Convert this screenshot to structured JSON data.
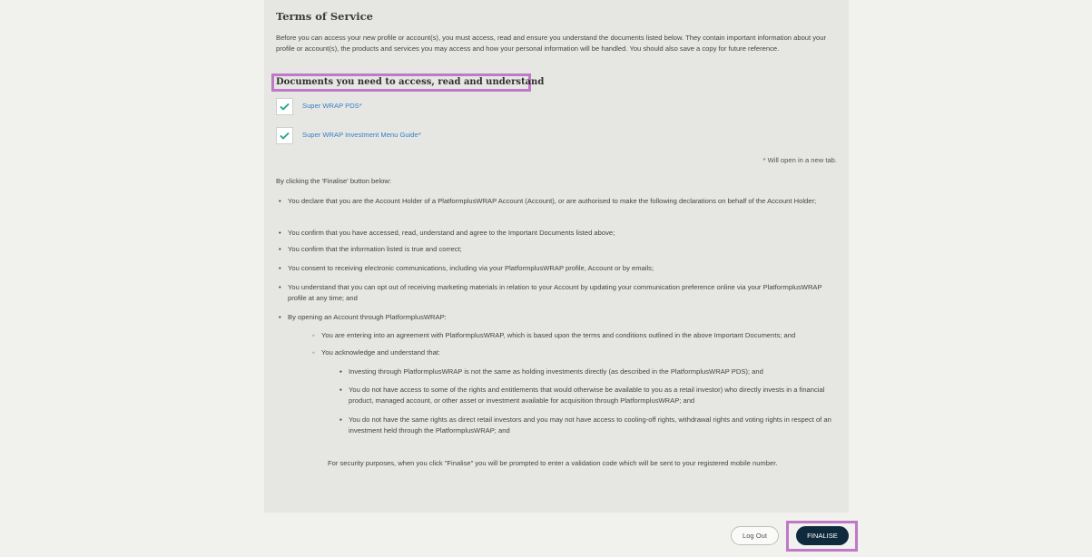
{
  "terms": {
    "title": "Terms of Service",
    "intro": "Before you can access your new profile or account(s), you must access, read and ensure you understand the documents listed below. They contain important information about your profile or account(s), the products and services you may access and how your personal information will be handled. You should also save a copy for future reference.",
    "documents_heading": "Documents you need to access, read and understand",
    "documents": [
      {
        "label": "Super WRAP PDS*",
        "checked": true
      },
      {
        "label": "Super WRAP Investment Menu Guide*",
        "checked": true
      }
    ],
    "new_tab_note": "* Will open in a new tab.",
    "clicking_intro": "By clicking the 'Finalise' button below:",
    "bullets": [
      "You declare that you are the Account Holder of a PlatformplusWRAP Account (Account), or are authorised to make the following declarations on behalf of the Account Holder;",
      "You confirm that you have accessed, read, understand and agree to the Important Documents listed above;",
      "You confirm that the information listed is true and correct;",
      "You consent to receiving electronic communications, including via your PlatformplusWRAP profile, Account or by emails;",
      "You understand that you can opt out of receiving marketing materials in relation to your Account by updating your communication preference online via your PlatformplusWRAP profile at any time; and",
      "By opening an Account through PlatformplusWRAP:"
    ],
    "sub_bullets": [
      "You are entering into an agreement with PlatformplusWRAP, which is based upon the terms and conditions outlined in the above Important Documents; and",
      "You acknowledge and understand that:"
    ],
    "sub_sub_bullets": [
      "Investing through PlatformplusWRAP is not the same as holding investments directly (as described in the PlatformplusWRAP PDS); and",
      "You do not have access to some of the rights and entitlements that would otherwise be available to you as a retail investor) who directly invests in a financial product, managed account, or other asset or investment available for acquisition through PlatformplusWRAP; and",
      "You do not have the same rights as direct retail investors and you may not have access to cooling-off rights, withdrawal rights and voting rights in respect of an investment held through the PlatformplusWRAP; and"
    ],
    "security_note": "For security purposes, when you click \"Finalise\" you will be prompted to enter a validation code which will be sent to your registered mobile number."
  },
  "actions": {
    "logout_label": "Log Out",
    "finalise_label": "FINALISE"
  },
  "colors": {
    "highlight": "#c078c8",
    "link": "#3a80c8",
    "check": "#1fa58a",
    "primary_button": "#0e2a3c"
  }
}
